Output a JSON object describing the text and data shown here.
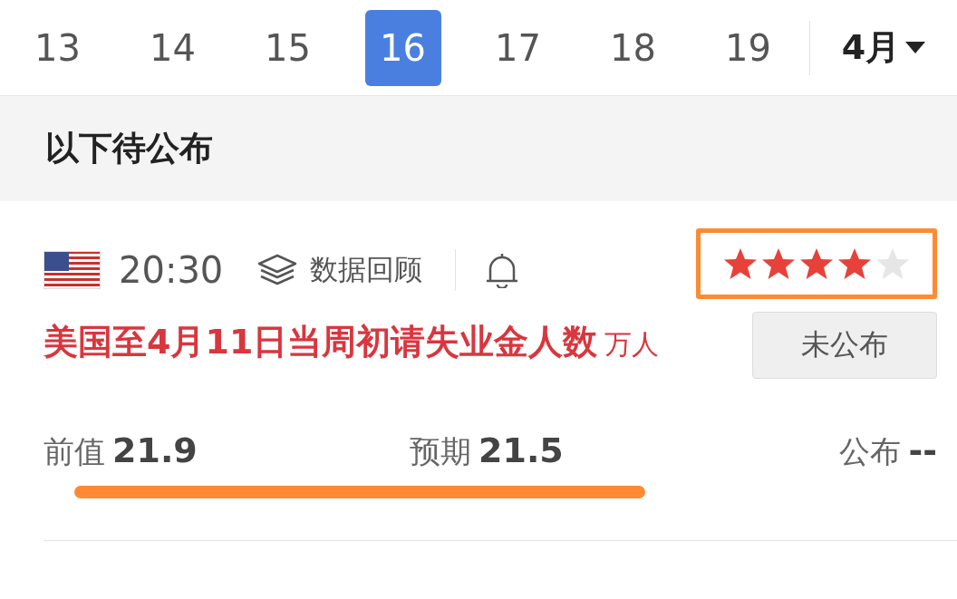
{
  "dates": [
    {
      "label": "13",
      "selected": false
    },
    {
      "label": "14",
      "selected": false
    },
    {
      "label": "15",
      "selected": false
    },
    {
      "label": "16",
      "selected": true
    },
    {
      "label": "17",
      "selected": false
    },
    {
      "label": "18",
      "selected": false
    },
    {
      "label": "19",
      "selected": false
    }
  ],
  "month": "4月",
  "section_title": "以下待公布",
  "event": {
    "time": "20:30",
    "review_label": "数据回顾",
    "stars": 4,
    "title": "美国至4月11日当周初请失业金人数",
    "unit": "万人",
    "status": "未公布",
    "stats": [
      {
        "label": "前值",
        "value": "21.9"
      },
      {
        "label": "预期",
        "value": "21.5"
      },
      {
        "label": "公布",
        "value": "--"
      }
    ]
  }
}
